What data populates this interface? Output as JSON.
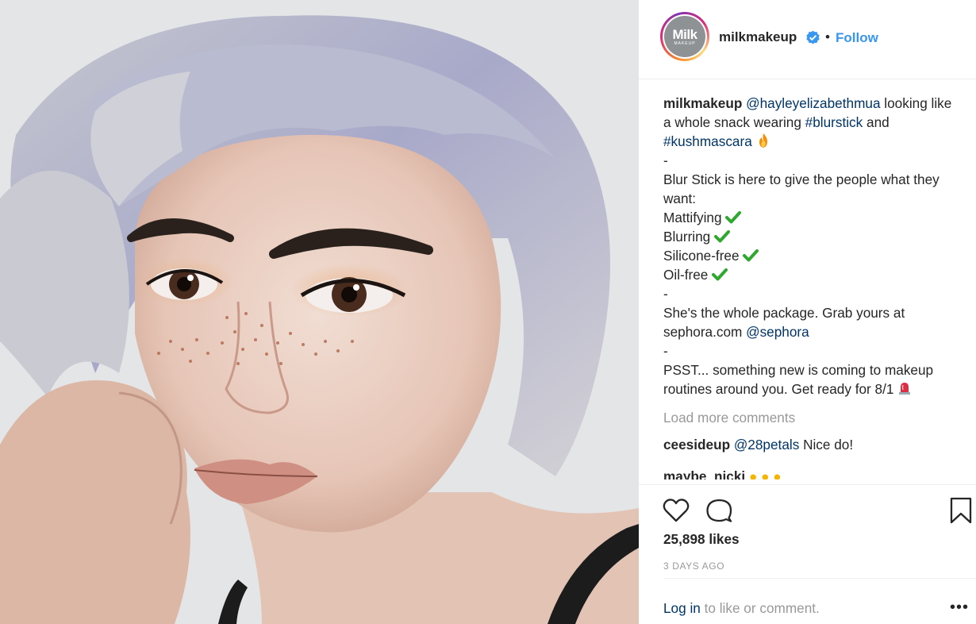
{
  "post": {
    "username": "milkmakeup",
    "follow_label": "Follow",
    "separator": "•",
    "avatar_logo": "Milk",
    "avatar_sub": "MAKEUP"
  },
  "caption": {
    "username": "milkmakeup",
    "mention": "@hayleyelizabethmua",
    "t1": " looking like a whole snack wearing ",
    "tag1": "#blurstick",
    "t2": " and ",
    "tag2": "#kushmascara",
    "dash1": "-",
    "line_intro": "Blur Stick is here to give the people what they want:",
    "features": [
      "Mattifying",
      "Blurring",
      "Silicone-free",
      "Oil-free"
    ],
    "dash2": "-",
    "pkg": "She's the whole package. Grab yours at sephora.com ",
    "mention2": "@sephora",
    "dash3": "-",
    "psst": "PSST... something new is coming to makeup routines around you. Get ready for 8/1 "
  },
  "load_more": "Load more comments",
  "comments": [
    {
      "user": "ceesideup",
      "mention": "@28petals",
      "text": " Nice do!"
    }
  ],
  "partial_comment_user": "maybe_nicki",
  "likes": "25,898 likes",
  "time": "3 DAYS AGO",
  "login": {
    "link": "Log in",
    "rest": " to like or comment."
  },
  "more_label": "•••",
  "icons": [
    "verified-icon",
    "heart-icon",
    "comment-icon",
    "bookmark-icon",
    "more-icon",
    "fire-emoji",
    "checkmark-emoji",
    "siren-emoji"
  ],
  "colors": {
    "link": "#003569",
    "follow": "#3897f0",
    "muted": "#999999",
    "text": "#262626",
    "verified": "#3897f0",
    "check": "#2fa82f"
  }
}
